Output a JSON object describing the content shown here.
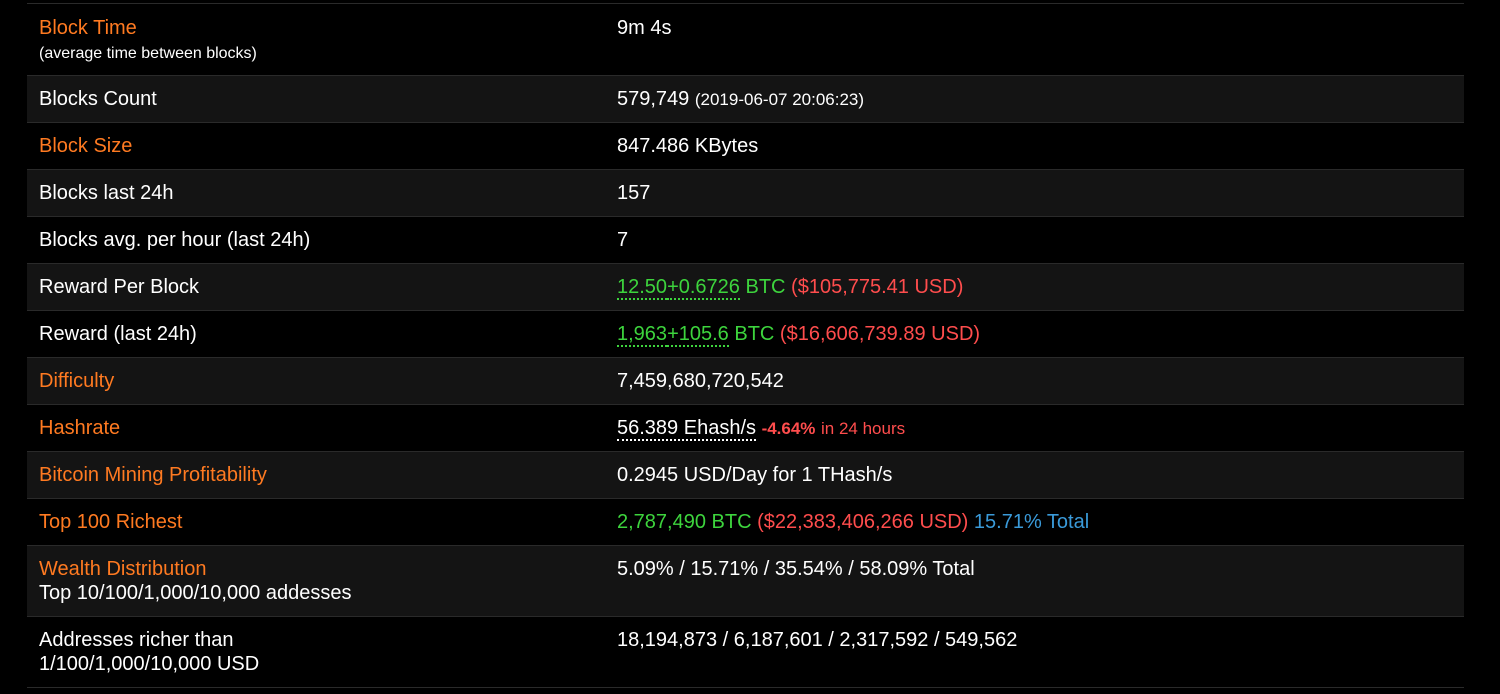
{
  "rows": [
    {
      "label": "Block Time",
      "sublabel": "(average time between blocks)",
      "value": "9m 4s"
    },
    {
      "label": "Blocks Count",
      "value": "579,749",
      "value_extra": "(2019-06-07 20:06:23)"
    },
    {
      "label": "Block Size",
      "value": "847.486 KBytes"
    },
    {
      "label": "Blocks last 24h",
      "value": "157"
    },
    {
      "label": "Blocks avg. per hour (last 24h)",
      "value": "7"
    },
    {
      "label": "Reward Per Block",
      "value_a": "12.50",
      "value_b": "+0.6726",
      "unit": "BTC",
      "usd": "($105,775.41 USD)"
    },
    {
      "label": "Reward (last 24h)",
      "value_a": "1,963",
      "value_b": "+105.6",
      "unit": "BTC",
      "usd": "($16,606,739.89 USD)"
    },
    {
      "label": "Difficulty",
      "value": "7,459,680,720,542"
    },
    {
      "label": "Hashrate",
      "value": "56.389 Ehash/s",
      "change": "-4.64%",
      "change_suffix": "in 24 hours"
    },
    {
      "label": "Bitcoin Mining Profitability",
      "value": "0.2945 USD/Day for 1 THash/s"
    },
    {
      "label": "Top 100 Richest",
      "btc": "2,787,490 BTC",
      "usd": "($22,383,406,266 USD)",
      "share": "15.71% Total"
    },
    {
      "label": "Wealth Distribution",
      "sublabel": "Top 10/100/1,000/10,000 addesses",
      "value": "5.09% / 15.71% / 35.54% / 58.09% Total"
    },
    {
      "label": "Addresses richer than",
      "sublabel": "1/100/1,000/10,000 USD",
      "value": "18,194,873 / 6,187,601 / 2,317,592 / 549,562"
    }
  ],
  "colors": {
    "background": "#000000",
    "row_alt": "#141414",
    "link_orange": "#ff7a21",
    "green": "#3dd43d",
    "red": "#ff4d4d",
    "blue": "#3a9ad9"
  }
}
